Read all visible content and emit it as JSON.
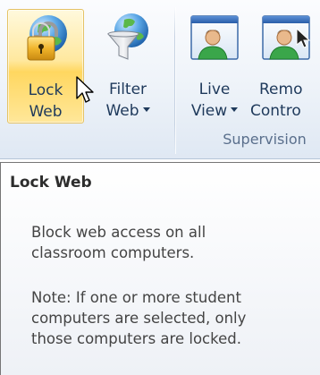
{
  "ribbon": {
    "buttons": [
      {
        "id": "lock-web",
        "label_line1": "Lock",
        "label_line2": "Web",
        "icon": "padlock-globe-icon",
        "state": "hovered"
      },
      {
        "id": "filter-web",
        "label_line1": "Filter",
        "label_line2": "Web",
        "icon": "funnel-globe-icon",
        "has_dropdown": true
      },
      {
        "id": "live-view",
        "label_line1": "Live",
        "label_line2": "View",
        "icon": "user-window-icon",
        "has_dropdown": true
      },
      {
        "id": "remote-control",
        "label_line1": "Remo",
        "label_line2": "Contro",
        "icon": "user-window-cursor-icon"
      }
    ],
    "group_label": "Supervision"
  },
  "tooltip": {
    "title": "Lock Web",
    "description_line1": "Block web access on all",
    "description_line2": "classroom computers.",
    "note_line1": "Note: If one or more student",
    "note_line2": "computers are selected, only",
    "note_line3": "those computers are locked."
  },
  "colors": {
    "ribbon_text": "#1e395b",
    "hover_border": "#e5c365",
    "hover_fill": "#ffd760",
    "group_label": "#5a6f8c",
    "tooltip_title": "#2d2d2d",
    "tooltip_text": "#444444"
  }
}
